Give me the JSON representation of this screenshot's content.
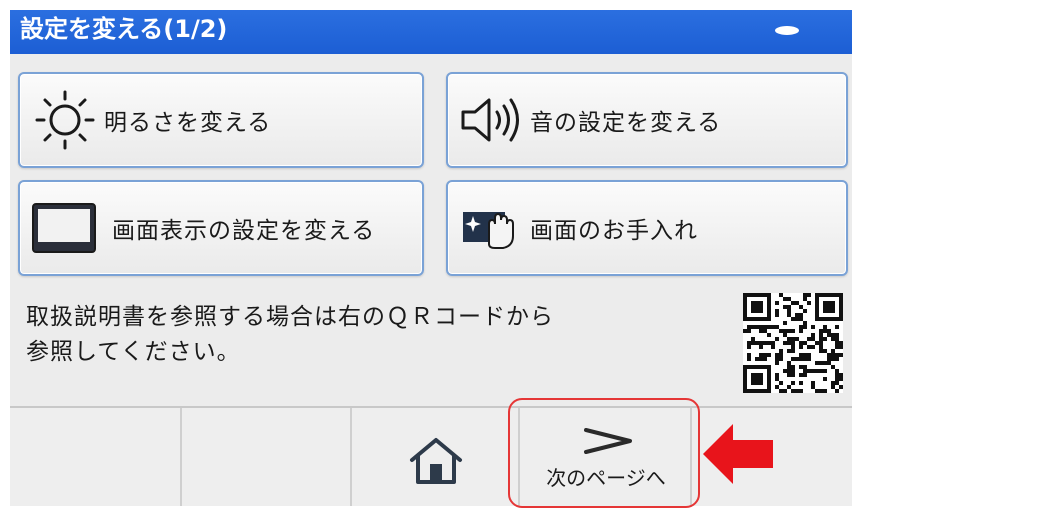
{
  "header": {
    "title": "設定を変える(1/2)"
  },
  "menu": {
    "brightness": {
      "label": "明るさを変える",
      "icon": "sun-icon"
    },
    "sound": {
      "label": "音の設定を変える",
      "icon": "speaker-icon"
    },
    "display": {
      "label": "画面表示の設定を変える",
      "icon": "monitor-icon"
    },
    "cleaning": {
      "label": "画面のお手入れ",
      "icon": "screen-clean-hand-icon"
    }
  },
  "info": {
    "line1": "取扱説明書を参照する場合は右のＱＲコードから",
    "line2": "参照してください。"
  },
  "footer": {
    "home_icon": "home-icon",
    "next_icon": "chevron-right-icon",
    "next_label": "次のページへ"
  },
  "colors": {
    "header_blue": "#1c5ed4",
    "button_border": "#7aa2d6",
    "highlight_red": "#e53636",
    "arrow_red": "#e8141b"
  }
}
